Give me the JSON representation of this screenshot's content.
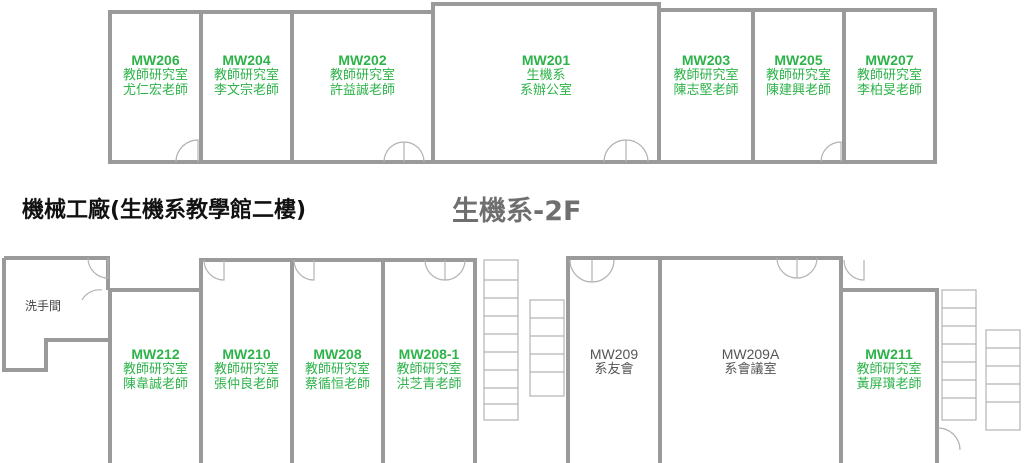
{
  "title": "機械工廠(生機系教學館二樓)",
  "subtitle": "生機系-2F",
  "restroom": "洗手間",
  "colors": {
    "office": "#2eb34a",
    "common": "#555555",
    "wall": "#9a9a9a",
    "title": "#111111",
    "subtitle": "#6f6f6f"
  },
  "upper_rooms": [
    {
      "id": "MW206",
      "line1": "教師研究室",
      "line2": "尤仁宏老師"
    },
    {
      "id": "MW204",
      "line1": "教師研究室",
      "line2": "李文宗老師"
    },
    {
      "id": "MW202",
      "line1": "教師研究室",
      "line2": "許益誠老師"
    },
    {
      "id": "MW201",
      "line1": "生機系",
      "line2": "系辦公室"
    },
    {
      "id": "MW203",
      "line1": "教師研究室",
      "line2": "陳志堅老師"
    },
    {
      "id": "MW205",
      "line1": "教師研究室",
      "line2": "陳建興老師"
    },
    {
      "id": "MW207",
      "line1": "教師研究室",
      "line2": "李柏旻老師"
    }
  ],
  "lower_rooms": [
    {
      "id": "MW212",
      "line1": "教師研究室",
      "line2": "陳韋誠老師"
    },
    {
      "id": "MW210",
      "line1": "教師研究室",
      "line2": "張仲良老師"
    },
    {
      "id": "MW208",
      "line1": "教師研究室",
      "line2": "蔡循恒老師"
    },
    {
      "id": "MW208-1",
      "line1": "教師研究室",
      "line2": "洪芝青老師"
    },
    {
      "id": "MW209",
      "line1": "系友會",
      "line2": ""
    },
    {
      "id": "MW209A",
      "line1": "系會議室",
      "line2": ""
    },
    {
      "id": "MW211",
      "line1": "教師研究室",
      "line2": "黃屏瓚老師"
    }
  ]
}
